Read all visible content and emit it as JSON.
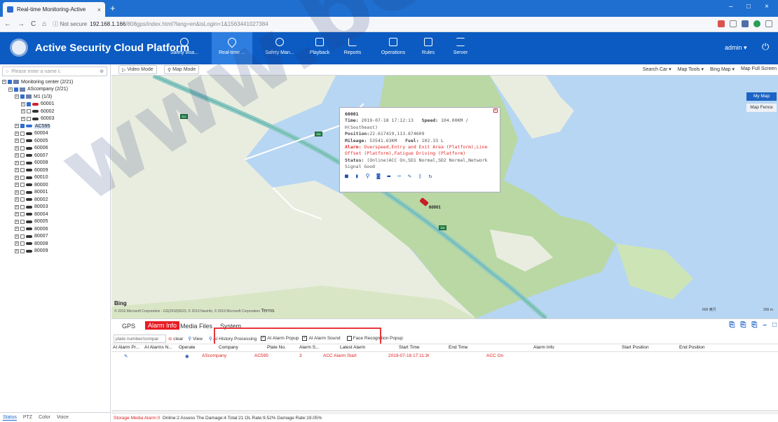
{
  "browser": {
    "tab_title": "Real-time Monitoring-Active",
    "tab_close": "×",
    "new_tab": "+",
    "nav_back": "←",
    "nav_forward": "→",
    "nav_reload": "C",
    "nav_home": "⌂",
    "secure_label": "ⓘ Not secure",
    "url_host": "192.168.1.166",
    "url_path": "/808gps/index.html?lang=en&isLogin=1&1563441027384",
    "win_min": "–",
    "win_max": "□",
    "win_close": "×"
  },
  "header": {
    "title": "Active Security Cloud Platform",
    "nav": [
      {
        "label": "Safety Boa...",
        "icon": "shield-icon"
      },
      {
        "label": "Real-time ...",
        "icon": "location-pin-icon"
      },
      {
        "label": "Safety Man...",
        "icon": "shield-icon"
      },
      {
        "label": "Playback",
        "icon": "playback-icon"
      },
      {
        "label": "Reports",
        "icon": "chart-icon"
      },
      {
        "label": "Operations",
        "icon": "operations-icon"
      },
      {
        "label": "Rules",
        "icon": "window-icon"
      },
      {
        "label": "Server",
        "icon": "server-icon"
      }
    ],
    "user": "admin ▾",
    "power_icon": "⏻"
  },
  "sidebar": {
    "search_placeholder": "Please enter a name c",
    "tree": [
      {
        "label": "Monitoring center (2/21)",
        "level": 0,
        "type": "root"
      },
      {
        "label": "AScompany (2/21)",
        "level": 1,
        "type": "company"
      },
      {
        "label": "M1 (1/3)",
        "level": 2,
        "type": "group"
      },
      {
        "label": "60001",
        "level": 3,
        "type": "car-red",
        "checked": true
      },
      {
        "label": "60002",
        "level": 3,
        "type": "car",
        "checked": false
      },
      {
        "label": "60003",
        "level": 3,
        "type": "car",
        "checked": false
      },
      {
        "label": "AC595",
        "level": 2,
        "type": "car-blue",
        "checked": true,
        "selected": true
      },
      {
        "label": "60004",
        "level": 2,
        "type": "car",
        "checked": false
      },
      {
        "label": "60005",
        "level": 2,
        "type": "car",
        "checked": false
      },
      {
        "label": "60006",
        "level": 2,
        "type": "car",
        "checked": false
      },
      {
        "label": "60007",
        "level": 2,
        "type": "car",
        "checked": false
      },
      {
        "label": "60008",
        "level": 2,
        "type": "car",
        "checked": false
      },
      {
        "label": "60009",
        "level": 2,
        "type": "car",
        "checked": false
      },
      {
        "label": "60010",
        "level": 2,
        "type": "car",
        "checked": false
      },
      {
        "label": "80000",
        "level": 2,
        "type": "car",
        "checked": false
      },
      {
        "label": "80001",
        "level": 2,
        "type": "car",
        "checked": false
      },
      {
        "label": "80002",
        "level": 2,
        "type": "car",
        "checked": false
      },
      {
        "label": "80003",
        "level": 2,
        "type": "car",
        "checked": false
      },
      {
        "label": "80004",
        "level": 2,
        "type": "car",
        "checked": false
      },
      {
        "label": "80005",
        "level": 2,
        "type": "car",
        "checked": false
      },
      {
        "label": "80006",
        "level": 2,
        "type": "car",
        "checked": false
      },
      {
        "label": "80007",
        "level": 2,
        "type": "car",
        "checked": false
      },
      {
        "label": "80008",
        "level": 2,
        "type": "car",
        "checked": false
      },
      {
        "label": "80009",
        "level": 2,
        "type": "car",
        "checked": false
      }
    ],
    "bottom_tabs": [
      "Status",
      "PTZ",
      "Color",
      "Voice"
    ]
  },
  "map_toolbar": {
    "video_mode": "Video Mode",
    "map_mode": "Map Mode",
    "search_car": "Search Car ▾",
    "map_tools": "Map Tools ▾",
    "bing_map": "Bing Map ▾",
    "full_screen": "Map Full Screen"
  },
  "map": {
    "my_map": "My Map",
    "map_fence": "Map Fence",
    "bing": "Bing",
    "copyright": "© 2019 Microsoft Corporation - GS(2018)5023, © 2019 Navinfo, © 2019 Microsoft Corporation",
    "terms": "Terms",
    "scale_left": "600 英尺",
    "scale_right": "200 m",
    "vehicle_label": "60001",
    "shield_text": "G4",
    "colors": {
      "water": "#b7d6f3",
      "land": "#e9eddf",
      "park": "#b9d8a4",
      "road": "#8cc9c4"
    }
  },
  "popup": {
    "vehicle": "60001",
    "time_label": "Time:",
    "time": "2019-07-18 17:12:13",
    "speed_label": "Speed:",
    "speed": "104.00KM / H(Southeast)",
    "position_label": "Position:",
    "position": "22.617419,113.874609",
    "mileage_label": "Mileage:",
    "mileage": "53541.63KM",
    "fuel_label": "Fuel:",
    "fuel": "102.33 L",
    "alarm_label": "Alarm:",
    "alarm": "Overspeed,Entry and Exit Area (Platform),Line Offset (Platform),Fatigue Driving (Platform)",
    "status_label": "Status:",
    "status": "(Online)ACC On,SD1 Normal,SD2 Normal,Network Signal Good",
    "close": "×"
  },
  "bottom_tabs": {
    "gps": "GPS",
    "alarm": "Alarm Info",
    "media": "Media Files",
    "system": "System"
  },
  "alarm_tools": {
    "plate_placeholder": "plate number/compar",
    "clear": "clear",
    "view": "View",
    "ai_history": "AI History Processing",
    "ai_popup": "AI Alarm Popup",
    "ai_sound": "AI Alarm Sound",
    "face_popup": "Face Recognition Popup",
    "ai_popup_checked": true,
    "ai_sound_checked": true,
    "face_popup_checked": false
  },
  "table": {
    "headers": [
      "AI Alarm Pr...",
      "AI Alarms N...",
      "Operate",
      "Company",
      "Plate No.",
      "Alarm S...",
      "Latest Alarm",
      "Start Time",
      "End Time",
      "Alarm Info",
      "Start Position",
      "End Position"
    ],
    "rows": [
      {
        "company": "AScompany",
        "plate": "AC595",
        "alarm_s": "3",
        "latest": "ACC Alarm Start",
        "start": "2019-07-18 17:11:36",
        "end": "",
        "info": "ACC On",
        "start_pos": "",
        "end_pos": ""
      }
    ]
  },
  "status_bar": {
    "storage": "Storage Media Alarm:0",
    "rest": "Online:2  Assess The Damage:4  Total:21  OL Rate:9.52%  Damage Rate:19.05%"
  },
  "watermark": "www.bcz"
}
